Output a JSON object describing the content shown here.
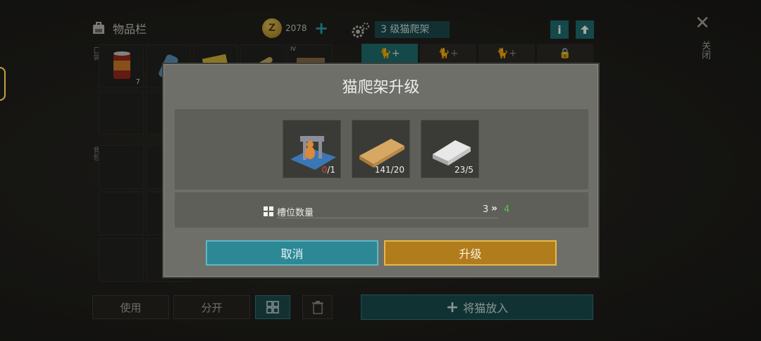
{
  "inventory": {
    "title": "物品栏",
    "coins": "2078",
    "pocket_label": "口袋",
    "backpack_label": "背包",
    "slot_apple_can_qty": "7",
    "slot_tier": "IV"
  },
  "crate": {
    "level_label": "3 级猫爬架",
    "info_label": "i"
  },
  "close_label": "关闭",
  "bottom": {
    "use_label": "使用",
    "split_label": "分开",
    "put_cat_label": "将猫放入"
  },
  "modal": {
    "title": "猫爬架升级",
    "materials": [
      {
        "name": "cat-tree",
        "count_have": "0",
        "count_need": "/1"
      },
      {
        "name": "wood-plank",
        "count": "141/20"
      },
      {
        "name": "metal-ingot",
        "count": "23/5"
      }
    ],
    "stat": {
      "label": "槽位数量",
      "from": "3",
      "to": "4"
    },
    "cancel_label": "取消",
    "upgrade_label": "升级"
  },
  "colors": {
    "teal": "#2d8896",
    "gold": "#b17c1c",
    "green": "#5cc24c",
    "red": "#e0463c"
  }
}
